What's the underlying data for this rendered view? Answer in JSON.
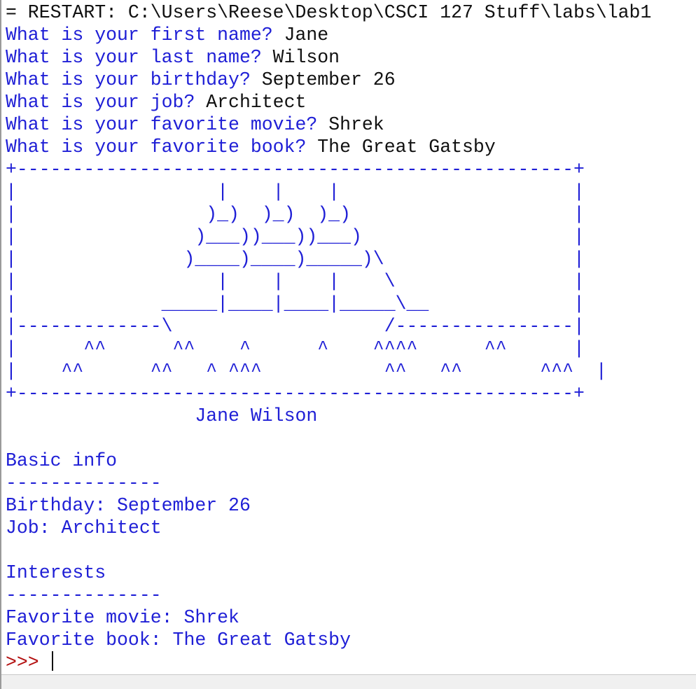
{
  "restart_line": "= RESTART: C:\\Users\\Reese\\Desktop\\CSCI 127 Stuff\\labs\\lab1",
  "questions": [
    {
      "prompt": "What is your first name? ",
      "answer": "Jane"
    },
    {
      "prompt": "What is your last name? ",
      "answer": "Wilson"
    },
    {
      "prompt": "What is your birthday? ",
      "answer": "September 26"
    },
    {
      "prompt": "What is your job? ",
      "answer": "Architect"
    },
    {
      "prompt": "What is your favorite movie? ",
      "answer": "Shrek"
    },
    {
      "prompt": "What is your favorite book? ",
      "answer": "The Great Gatsby"
    }
  ],
  "ascii_art": [
    "+--------------------------------------------------+",
    "|                  |    |    |                     |",
    "|                 )_)  )_)  )_)                    |",
    "|                )___))___))___)                   |",
    "|               )____)____)_____)\\                 |",
    "|                  |    |    |    \\                |",
    "|             _____|____|____|_____\\__             |",
    "|-------------\\                   /----------------|",
    "|      ^^      ^^    ^      ^    ^^^^      ^^      |",
    "|    ^^      ^^   ^ ^^^           ^^   ^^       ^^^  |",
    "+--------------------------------------------------+"
  ],
  "name_line": "                 Jane Wilson",
  "basic_info": {
    "heading": "Basic info",
    "rule": "--------------",
    "birthday": "Birthday: September 26",
    "job": "Job: Architect"
  },
  "interests": {
    "heading": "Interests",
    "rule": "--------------",
    "movie": "Favorite movie: Shrek",
    "book": "Favorite book: The Great Gatsby"
  },
  "prompt_symbol": ">>> "
}
